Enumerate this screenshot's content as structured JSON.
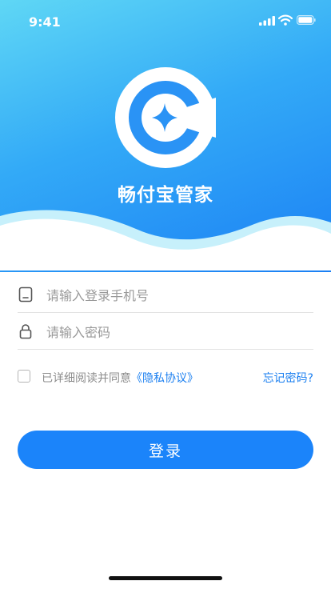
{
  "status_bar": {
    "time": "9:41",
    "icons": [
      "signal-icon",
      "wifi-icon",
      "battery-icon"
    ]
  },
  "brand": {
    "app_name": "畅付宝管家",
    "logo_icon": "logo-c-star-icon",
    "colors": {
      "header_gradient": [
        "#5fd7f5",
        "#33aaf7",
        "#1b80f4"
      ],
      "accent": "#1b84fa"
    }
  },
  "form": {
    "phone": {
      "placeholder": "请输入登录手机号",
      "value": "",
      "icon": "phone-icon"
    },
    "password": {
      "placeholder": "请输入密码",
      "value": "",
      "icon": "lock-icon"
    },
    "agreement": {
      "checked": false,
      "text": "已详细阅读并同意",
      "link_text": "《隐私协议》"
    },
    "forgot_password": "忘记密码?",
    "login_button": "登录"
  }
}
